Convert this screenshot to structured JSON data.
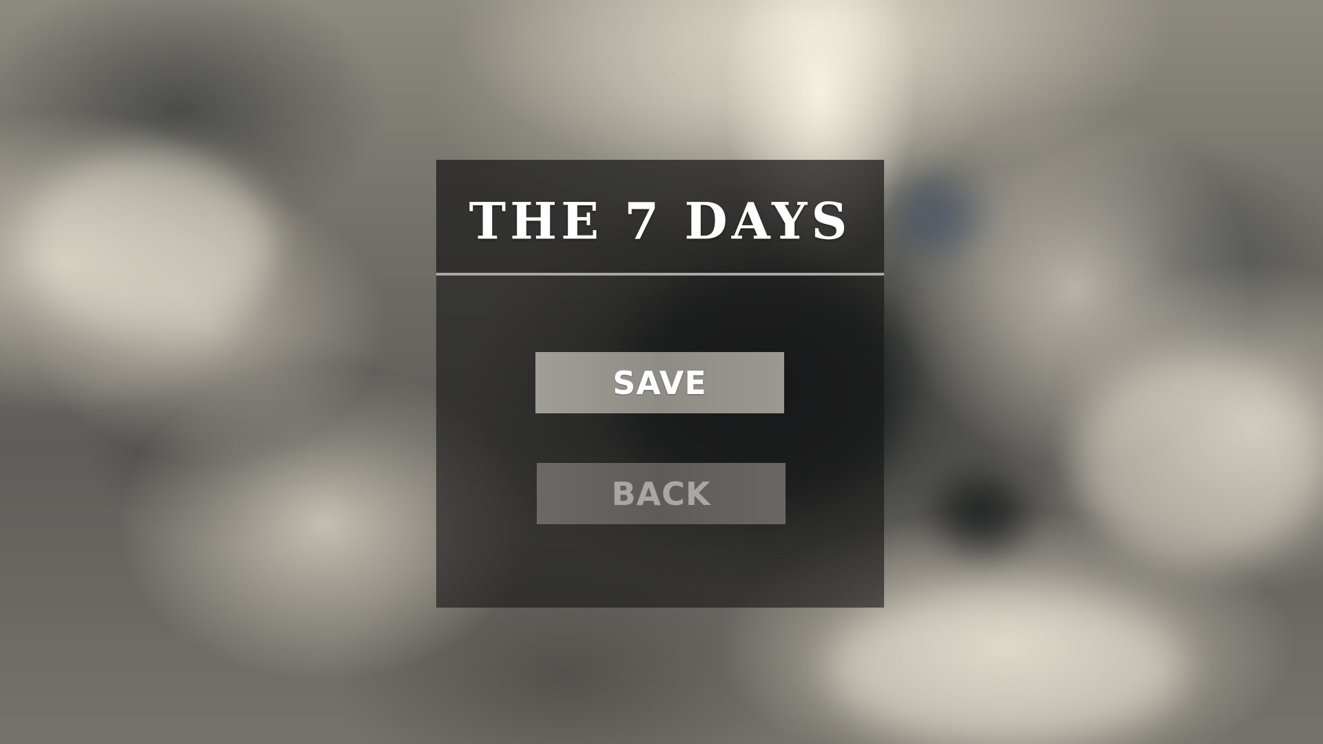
{
  "game": {
    "title": "THE 7 DAYS"
  },
  "menu": {
    "save_label": "SAVE",
    "back_label": "BACK"
  }
}
